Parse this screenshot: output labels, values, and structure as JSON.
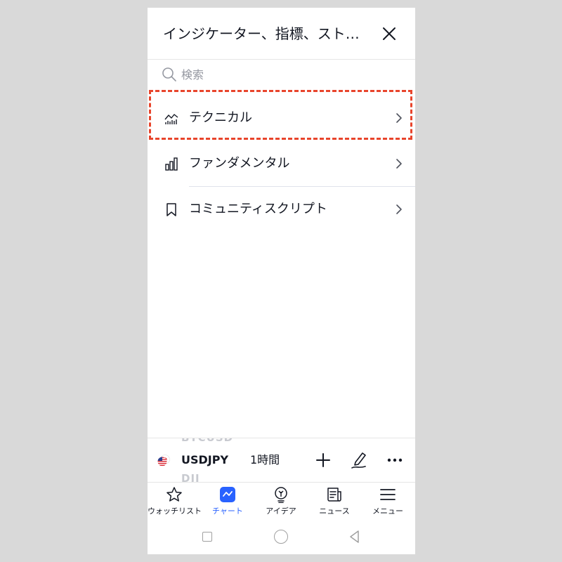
{
  "header": {
    "title": "インジケーター、指標、スト…"
  },
  "search": {
    "placeholder": "検索",
    "value": ""
  },
  "categories": [
    {
      "label": "テクニカル",
      "icon": "technical-chart-icon",
      "highlighted": true
    },
    {
      "label": "ファンダメンタル",
      "icon": "bar-chart-icon",
      "highlighted": false
    },
    {
      "label": "コミュニティスクリプト",
      "icon": "bookmark-icon",
      "highlighted": false
    }
  ],
  "symbol_bar": {
    "ghost_above": "BTCUSD",
    "ghost_below": "DJI",
    "symbol": "USDJPY",
    "interval": "1時間"
  },
  "bottom_nav": [
    {
      "label": "ウォッチリスト",
      "icon": "star-icon",
      "active": false
    },
    {
      "label": "チャート",
      "icon": "chart-icon",
      "active": true
    },
    {
      "label": "アイデア",
      "icon": "lightbulb-icon",
      "active": false
    },
    {
      "label": "ニュース",
      "icon": "news-icon",
      "active": false
    },
    {
      "label": "メニュー",
      "icon": "menu-icon",
      "active": false
    }
  ],
  "colors": {
    "accent": "#2962ff",
    "highlight_border": "#e8452c",
    "text": "#131722",
    "muted": "#9598a1"
  }
}
